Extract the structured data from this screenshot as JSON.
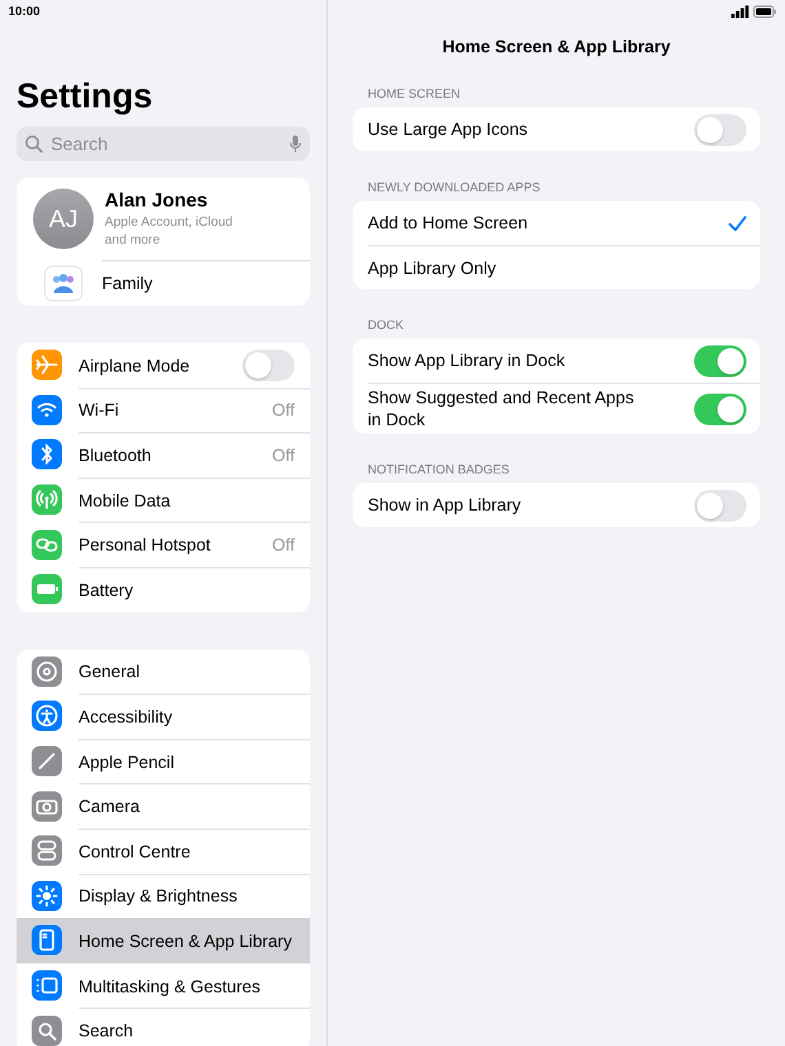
{
  "status_bar": {
    "time": "10:00"
  },
  "sidebar": {
    "title": "Settings",
    "search": {
      "placeholder": "Search"
    },
    "profile": {
      "initials": "AJ",
      "name": "Alan Jones",
      "subtitle": "Apple Account, iCloud and more",
      "family": "Family"
    },
    "groups": [
      [
        {
          "label": "Airplane Mode",
          "color": "#ff9500",
          "kind": "toggle",
          "on": false,
          "selected": false
        },
        {
          "label": "Wi-Fi",
          "color": "#007aff",
          "kind": "value",
          "value": "Off",
          "selected": false
        },
        {
          "label": "Bluetooth",
          "color": "#007aff",
          "kind": "value",
          "value": "Off",
          "selected": false
        },
        {
          "label": "Mobile Data",
          "color": "#34c759",
          "kind": "plain",
          "selected": false
        },
        {
          "label": "Personal Hotspot",
          "color": "#34c759",
          "kind": "value",
          "value": "Off",
          "selected": false
        },
        {
          "label": "Battery",
          "color": "#34c759",
          "kind": "plain",
          "selected": false
        }
      ],
      [
        {
          "label": "General",
          "color": "#8e8e93",
          "kind": "plain",
          "selected": false
        },
        {
          "label": "Accessibility",
          "color": "#007aff",
          "kind": "plain",
          "selected": false
        },
        {
          "label": "Apple Pencil",
          "color": "#8e8e93",
          "kind": "plain",
          "selected": false
        },
        {
          "label": "Camera",
          "color": "#8e8e93",
          "kind": "plain",
          "selected": false
        },
        {
          "label": "Control Centre",
          "color": "#8e8e93",
          "kind": "plain",
          "selected": false
        },
        {
          "label": "Display & Brightness",
          "color": "#007aff",
          "kind": "plain",
          "selected": false
        },
        {
          "label": "Home Screen & App Library",
          "color": "#007aff",
          "kind": "plain",
          "selected": true
        },
        {
          "label": "Multitasking & Gestures",
          "color": "#007aff",
          "kind": "plain",
          "selected": false
        },
        {
          "label": "Search",
          "color": "#8e8e93",
          "kind": "plain",
          "selected": false
        }
      ]
    ]
  },
  "detail": {
    "title": "Home Screen & App Library",
    "sections": [
      {
        "header": "HOME SCREEN",
        "rows": [
          {
            "kind": "toggle",
            "label": "Use Large App Icons",
            "on": false
          }
        ]
      },
      {
        "header": "NEWLY DOWNLOADED APPS",
        "rows": [
          {
            "kind": "choice",
            "label": "Add to Home Screen",
            "selected": true
          },
          {
            "kind": "choice",
            "label": "App Library Only",
            "selected": false
          }
        ]
      },
      {
        "header": "DOCK",
        "rows": [
          {
            "kind": "toggle",
            "label": "Show App Library in Dock",
            "on": true
          },
          {
            "kind": "toggle",
            "label": "Show Suggested and Recent Apps in Dock",
            "on": true
          }
        ]
      },
      {
        "header": "NOTIFICATION BADGES",
        "rows": [
          {
            "kind": "toggle",
            "label": "Show in App Library",
            "on": false
          }
        ]
      }
    ]
  }
}
